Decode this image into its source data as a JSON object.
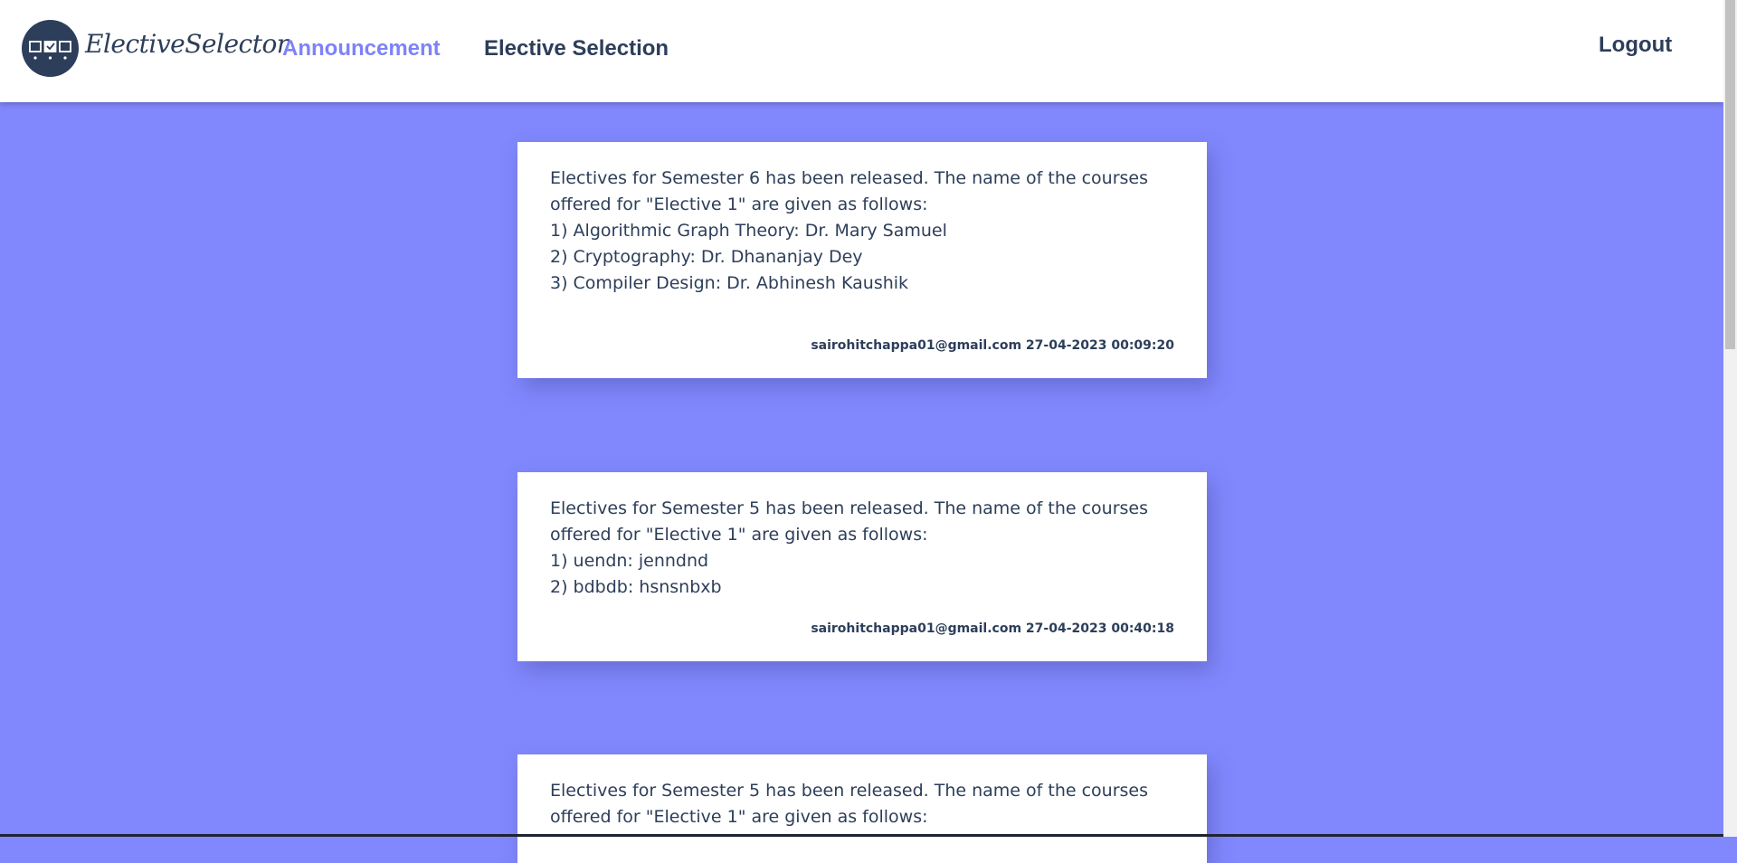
{
  "navbar": {
    "brand": "ElectiveSelector",
    "links": {
      "announcement": "Announcement",
      "elective_selection": "Elective Selection",
      "logout": "Logout"
    }
  },
  "announcements": [
    {
      "text": "Electives for Semester 6 has been released. The name of the courses offered for \"Elective 1\" are given as follows:\n1) Algorithmic Graph Theory: Dr. Mary Samuel\n2) Cryptography: Dr. Dhananjay Dey\n3) Compiler Design: Dr. Abhinesh Kaushik",
      "meta": "sairohitchappa01@gmail.com 27-04-2023 00:09:20"
    },
    {
      "text": "Electives for Semester 5 has been released. The name of the courses offered for \"Elective 1\" are given as follows:\n1) uendn: jenndnd\n2) bdbdb: hsnsnbxb",
      "meta": "sairohitchappa01@gmail.com 27-04-2023 00:40:18"
    },
    {
      "text": "Electives for Semester 5 has been released. The name of the courses offered for \"Elective 1\" are given as follows:"
    }
  ],
  "colors": {
    "page_background": "#8188fd",
    "accent": "#7d83f7",
    "text_dark": "#2d3e5a",
    "card_background": "#ffffff"
  },
  "icons": [
    "checkbox-logo-icon"
  ]
}
